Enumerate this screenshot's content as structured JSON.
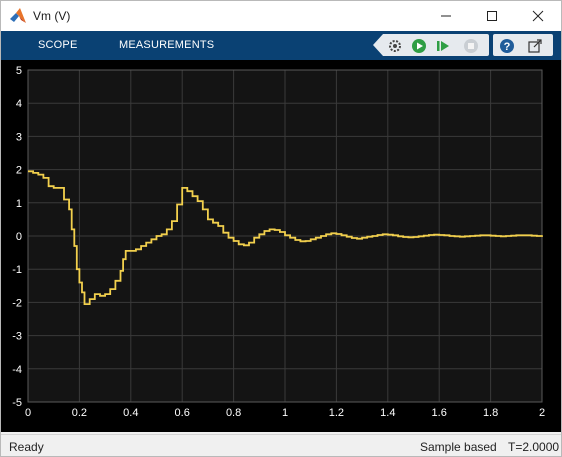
{
  "window": {
    "title": "Vm (V)"
  },
  "toolstrip": {
    "tabs": [
      {
        "label": "SCOPE"
      },
      {
        "label": "MEASUREMENTS"
      }
    ]
  },
  "status": {
    "ready": "Ready",
    "mode": "Sample based",
    "time": "T=2.0000"
  },
  "colors": {
    "toolstrip": "#0a4173",
    "plot_background": "#141414",
    "grid": "#3a3a3a",
    "signal": "#f2d04d",
    "tick_text": "#ffffff"
  },
  "chart_data": {
    "type": "line",
    "title": "",
    "xlabel": "",
    "ylabel": "",
    "xlim": [
      0,
      2
    ],
    "ylim": [
      -5,
      5
    ],
    "x_ticks": [
      "0",
      "0.2",
      "0.4",
      "0.6",
      "0.8",
      "1",
      "1.2",
      "1.4",
      "1.6",
      "1.8",
      "2"
    ],
    "y_ticks": [
      "5",
      "4",
      "3",
      "2",
      "1",
      "0",
      "-1",
      "-2",
      "-3",
      "-4",
      "-5"
    ],
    "grid": true,
    "series": [
      {
        "x": [
          0,
          0.02,
          0.04,
          0.06,
          0.08,
          0.1,
          0.12,
          0.14,
          0.16,
          0.17,
          0.18,
          0.19,
          0.2,
          0.21,
          0.22,
          0.24,
          0.26,
          0.28,
          0.3,
          0.32,
          0.34,
          0.36,
          0.37,
          0.38,
          0.4,
          0.42,
          0.44,
          0.46,
          0.48,
          0.5,
          0.52,
          0.54,
          0.56,
          0.58,
          0.6,
          0.62,
          0.64,
          0.66,
          0.68,
          0.7,
          0.72,
          0.74,
          0.76,
          0.78,
          0.8,
          0.82,
          0.84,
          0.86,
          0.88,
          0.9,
          0.92,
          0.94,
          0.96,
          0.98,
          1.0,
          1.02,
          1.04,
          1.06,
          1.08,
          1.1,
          1.12,
          1.14,
          1.16,
          1.18,
          1.2,
          1.22,
          1.24,
          1.26,
          1.28,
          1.3,
          1.32,
          1.34,
          1.36,
          1.38,
          1.4,
          1.42,
          1.44,
          1.46,
          1.48,
          1.5,
          1.52,
          1.54,
          1.56,
          1.58,
          1.6,
          1.62,
          1.64,
          1.66,
          1.68,
          1.7,
          1.72,
          1.74,
          1.76,
          1.78,
          1.8,
          1.82,
          1.84,
          1.86,
          1.88,
          1.9,
          1.92,
          1.94,
          1.96,
          1.98,
          2.0
        ],
        "y": [
          1.95,
          1.9,
          1.85,
          1.75,
          1.5,
          1.45,
          1.45,
          1.1,
          0.8,
          0.2,
          -0.3,
          -1.0,
          -1.4,
          -1.7,
          -2.05,
          -1.9,
          -1.75,
          -1.8,
          -1.75,
          -1.6,
          -1.35,
          -1.05,
          -0.7,
          -0.45,
          -0.45,
          -0.4,
          -0.3,
          -0.2,
          -0.1,
          0.0,
          0.05,
          0.2,
          0.45,
          0.95,
          1.45,
          1.35,
          1.2,
          1.05,
          0.8,
          0.5,
          0.4,
          0.3,
          0.1,
          -0.05,
          -0.15,
          -0.25,
          -0.28,
          -0.2,
          -0.05,
          0.05,
          0.15,
          0.2,
          0.18,
          0.12,
          0.02,
          -0.05,
          -0.12,
          -0.16,
          -0.15,
          -0.1,
          -0.05,
          0.0,
          0.05,
          0.08,
          0.06,
          0.02,
          -0.02,
          -0.06,
          -0.08,
          -0.05,
          -0.02,
          0.0,
          0.03,
          0.05,
          0.04,
          0.02,
          -0.01,
          -0.03,
          -0.04,
          -0.03,
          -0.01,
          0.01,
          0.03,
          0.04,
          0.03,
          0.02,
          0.0,
          -0.01,
          -0.02,
          -0.01,
          0.0,
          0.01,
          0.02,
          0.02,
          0.01,
          0.0,
          -0.01,
          0.0,
          0.01,
          0.02,
          0.02,
          0.02,
          0.01,
          0.0,
          0.02
        ]
      }
    ]
  }
}
